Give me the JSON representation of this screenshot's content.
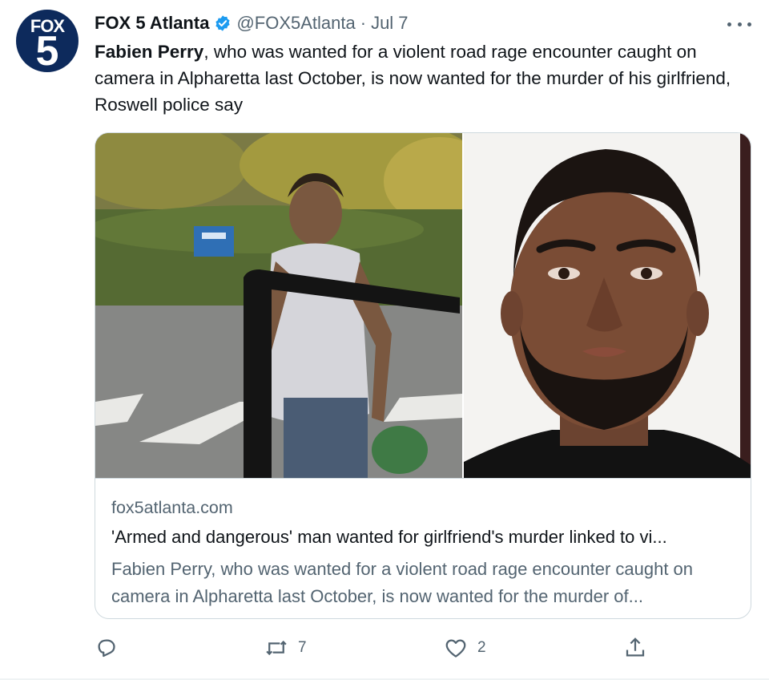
{
  "account": {
    "avatar_top": "FOX",
    "avatar_bottom": "5",
    "name": "FOX 5 Atlanta",
    "handle": "@FOX5Atlanta",
    "separator": "·",
    "date": "Jul 7",
    "verified": true
  },
  "tweet": {
    "bold_name": "Fabien Perry",
    "body": ", who was wanted for a violent road rage encounter caught on camera in Alpharetta last October, is now wanted for the murder of his girlfriend, Roswell police say"
  },
  "card": {
    "domain": "fox5atlanta.com",
    "title": "'Armed and dangerous' man wanted for girlfriend's murder linked to vi...",
    "description": "Fabien Perry, who was wanted for a violent road rage encounter caught on camera in Alpharetta last October, is now wanted for the murder of...",
    "image_left": "road-rage-video-still",
    "image_right": "suspect-mugshot"
  },
  "actions": {
    "reply_icon": "reply-icon",
    "retweet_icon": "retweet-icon",
    "retweet_count": "7",
    "like_icon": "heart-icon",
    "like_count": "2",
    "share_icon": "share-icon"
  },
  "colors": {
    "verified_blue": "#1d9bf0",
    "secondary_text": "#536471",
    "primary_text": "#0f1419",
    "border": "#cfd9de",
    "avatar_bg": "#0d2a5c"
  }
}
